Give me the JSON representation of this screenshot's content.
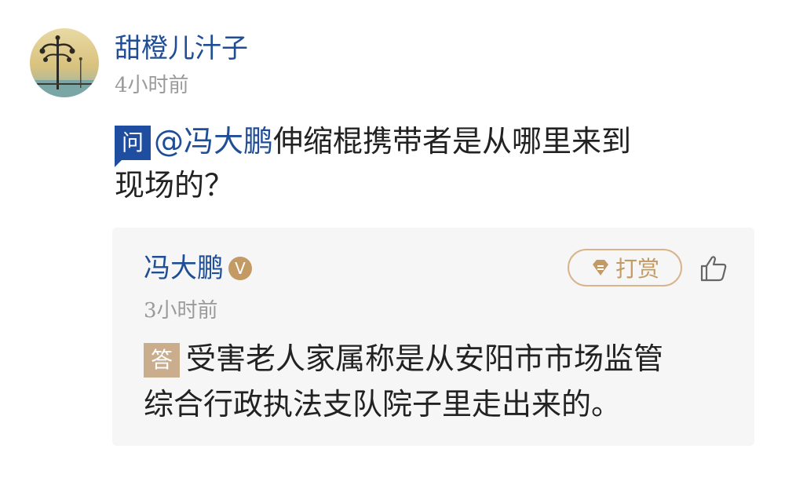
{
  "question": {
    "asker": {
      "name": "甜橙儿汁子",
      "time": "4小时前",
      "avatar_icon": "streetlamp-avatar"
    },
    "badge": "问",
    "mention": "@冯大鹏",
    "text_line1": "伸缩棍携带者是从哪里来到",
    "text_line2": "现场的？"
  },
  "answer": {
    "answerer": {
      "name": "冯大鹏",
      "verified_badge": "V"
    },
    "tip_label": "打赏",
    "tip_icon": "diamond-icon",
    "like_icon": "thumbs-up-icon",
    "time": "3小时前",
    "badge": "答",
    "text_line1": "受害老人家属称是从安阳市市场监管",
    "text_line2": "综合行政执法支队院子里走出来的。"
  },
  "colors": {
    "link_blue": "#1f4e96",
    "question_badge": "#1f4ea0",
    "answer_badge": "#c9ad8c",
    "gold": "#c39a64",
    "card_bg": "#f6f6f6",
    "meta_gray": "#9a9a9a"
  }
}
